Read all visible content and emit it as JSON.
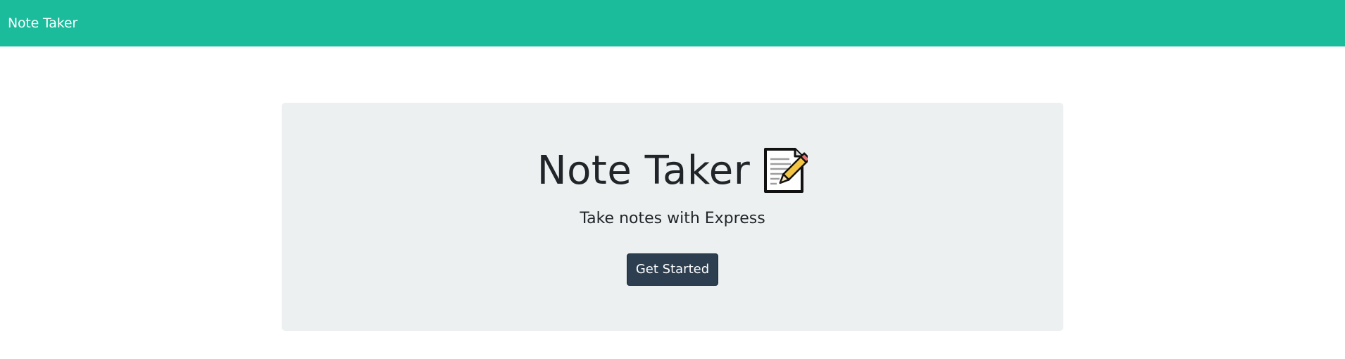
{
  "navbar": {
    "brand": "Note Taker",
    "background_color": "#1abc9c"
  },
  "hero": {
    "title": "Note Taker",
    "title_icon": "memo-icon",
    "subtitle": "Take notes with Express",
    "button_label": "Get Started",
    "background_color": "#ecf0f1",
    "button_color": "#2c3e50"
  }
}
